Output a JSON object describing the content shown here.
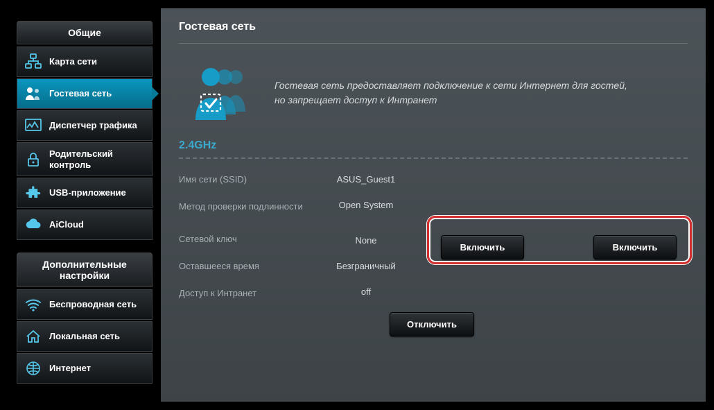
{
  "sidebar": {
    "group_general": "Общие",
    "group_advanced": "Дополнительные настройки",
    "items_general": [
      "Карта сети",
      "Гостевая сеть",
      "Диспетчер трафика",
      "Родительский контроль",
      "USB-приложение",
      "AiCloud"
    ],
    "items_advanced": [
      "Беспроводная сеть",
      "Локальная сеть",
      "Интернет"
    ]
  },
  "page": {
    "title": "Гостевая сеть",
    "hero_line1": "Гостевая сеть предоставляет подключение к сети Интернет для гостей,",
    "hero_line2": "но запрещает доступ к Интранет",
    "band": "2.4GHz"
  },
  "net": {
    "labels": {
      "ssid": "Имя сети (SSID)",
      "auth": "Метод проверки подлинности",
      "key": "Сетевой ключ",
      "time": "Оставшееся время",
      "intranet": "Доступ к Интранет"
    },
    "values": {
      "ssid": "ASUS_Guest1",
      "auth": "Open System",
      "key": "None",
      "time": "Безграничный",
      "intranet": "off"
    }
  },
  "buttons": {
    "enable1": "Включить",
    "enable2": "Включить",
    "disable": "Отключить"
  }
}
